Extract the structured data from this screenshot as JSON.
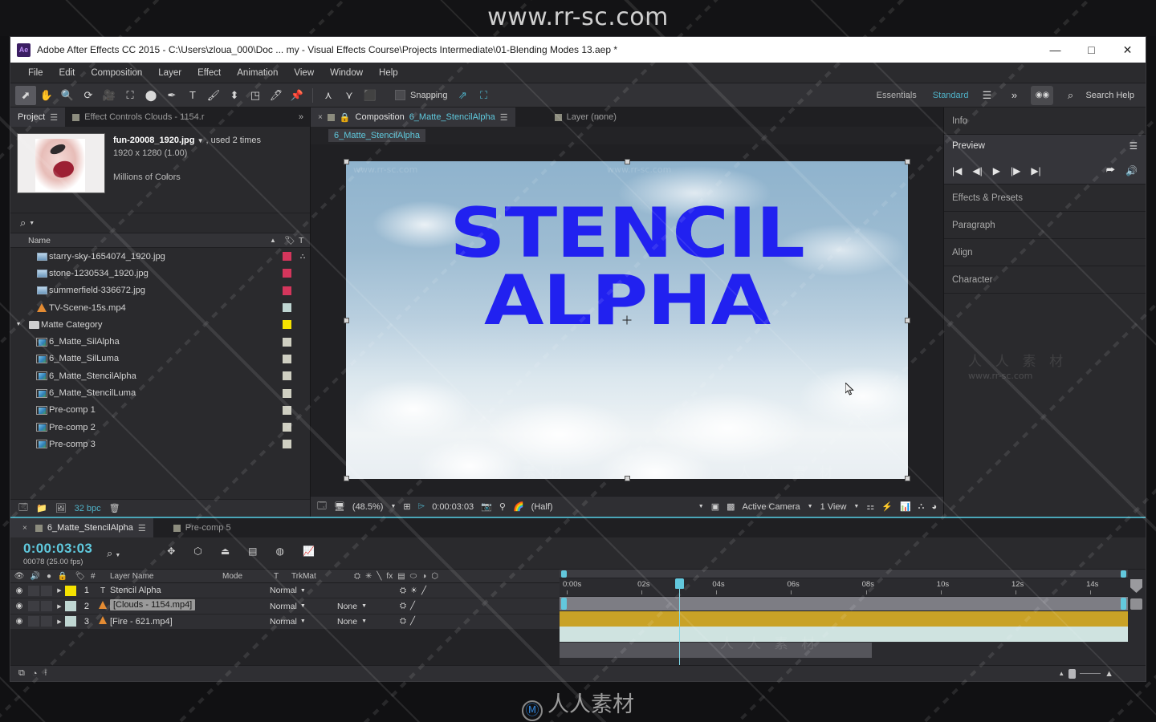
{
  "watermarks": {
    "top_url": "www.rr-sc.com",
    "bottom_brand": "人人素材",
    "overlay_url": "www.rr-sc.com",
    "overlay_cn": "人 人 素 材"
  },
  "titlebar": {
    "logo": "Ae",
    "title": "Adobe After Effects CC 2015 - C:\\Users\\zloua_000\\Doc ... my - Visual Effects Course\\Projects Intermediate\\01-Blending Modes 13.aep *",
    "minimize": "—",
    "maximize": "□",
    "close": "✕"
  },
  "menubar": {
    "items": [
      "File",
      "Edit",
      "Composition",
      "Layer",
      "Effect",
      "Animation",
      "View",
      "Window",
      "Help"
    ]
  },
  "toolbar": {
    "tools": [
      {
        "name": "selection-tool",
        "glyph": "⬈",
        "selected": true
      },
      {
        "name": "hand-tool",
        "glyph": "✋",
        "selected": false
      },
      {
        "name": "zoom-tool",
        "glyph": "🔍",
        "selected": false
      },
      {
        "name": "rotation-tool",
        "glyph": "⟳",
        "selected": false
      },
      {
        "name": "camera-tool",
        "glyph": "🎥",
        "selected": false
      },
      {
        "name": "pan-behind-tool",
        "glyph": "⛶",
        "selected": false
      },
      {
        "name": "shape-tool",
        "glyph": "⬤",
        "selected": false
      },
      {
        "name": "pen-tool",
        "glyph": "✒",
        "selected": false
      },
      {
        "name": "text-tool",
        "glyph": "T",
        "selected": false
      },
      {
        "name": "brush-tool",
        "glyph": "🖌",
        "selected": false
      },
      {
        "name": "clone-stamp-tool",
        "glyph": "⬍",
        "selected": false
      },
      {
        "name": "eraser-tool",
        "glyph": "◳",
        "selected": false
      },
      {
        "name": "roto-brush-tool",
        "glyph": "🖊",
        "selected": false
      },
      {
        "name": "puppet-pin-tool",
        "glyph": "📌",
        "selected": false
      }
    ],
    "puppet_tools": [
      {
        "name": "puppet-position-tool",
        "glyph": "⋏"
      },
      {
        "name": "puppet-starch-tool",
        "glyph": "⋎"
      },
      {
        "name": "puppet-overlap-tool",
        "glyph": "⬛"
      }
    ],
    "snapping_label": "Snapping",
    "snapping_icons": [
      "magnet-icon",
      "grid-snap-icon"
    ],
    "workspaces": [
      {
        "label": "Essentials",
        "active": false
      },
      {
        "label": "Standard",
        "active": true
      }
    ],
    "workspace_menu_icon": "hamburger-icon",
    "overflow_icon": "chevron-double-right-icon",
    "adobe_link_icon": "creative-cloud-icon",
    "search_help_placeholder": "Search Help",
    "search_icon": "search-icon"
  },
  "project_panel": {
    "tabs": [
      {
        "label": "Project",
        "active": true,
        "has_menu": true
      },
      {
        "label": "Effect Controls Clouds - 1154.r",
        "active": false,
        "has_menu": false
      }
    ],
    "overflow_icon": "chevron-double-right-icon",
    "selected_asset": {
      "filename": "fun-20008_1920.jpg",
      "used": ", used 2 times",
      "dimensions": "1920 x 1280 (1.00)",
      "color_depth": "Millions of Colors",
      "dropdown_icon": "caret-down-icon"
    },
    "search_icon": "search-icon",
    "columns": {
      "name": "Name",
      "sort_icon": "caret-up-icon",
      "tag": "tag-icon",
      "type": "T"
    },
    "items": [
      {
        "name": "starry-sky-1654074_1920.jpg",
        "icon": "image-icon",
        "indent": 1,
        "swatch": "#d4365c",
        "extra": "share-icon"
      },
      {
        "name": "stone-1230534_1920.jpg",
        "icon": "image-icon",
        "indent": 1,
        "swatch": "#d4365c",
        "extra": ""
      },
      {
        "name": "summerfield-336672.jpg",
        "icon": "image-icon",
        "indent": 1,
        "swatch": "#d4365c",
        "extra": ""
      },
      {
        "name": "TV-Scene-15s.mp4",
        "icon": "video-icon",
        "indent": 1,
        "swatch": "#bfd6d2",
        "extra": ""
      },
      {
        "name": "Matte Category",
        "icon": "folder-icon",
        "indent": 0,
        "swatch": "#f5e200",
        "extra": "",
        "expanded": true
      },
      {
        "name": "6_Matte_SilAlpha",
        "icon": "comp-icon",
        "indent": 1,
        "swatch": "#cfcfc2",
        "extra": ""
      },
      {
        "name": "6_Matte_SilLuma",
        "icon": "comp-icon",
        "indent": 1,
        "swatch": "#cfcfc2",
        "extra": ""
      },
      {
        "name": "6_Matte_StencilAlpha",
        "icon": "comp-icon",
        "indent": 1,
        "swatch": "#cfcfc2",
        "extra": ""
      },
      {
        "name": "6_Matte_StencilLuma",
        "icon": "comp-icon",
        "indent": 1,
        "swatch": "#cfcfc2",
        "extra": ""
      },
      {
        "name": "Pre-comp 1",
        "icon": "comp-icon",
        "indent": 1,
        "swatch": "#cfcfc2",
        "extra": ""
      },
      {
        "name": "Pre-comp 2",
        "icon": "comp-icon",
        "indent": 1,
        "swatch": "#cfcfc2",
        "extra": ""
      },
      {
        "name": "Pre-comp 3",
        "icon": "comp-icon",
        "indent": 1,
        "swatch": "#cfcfc2",
        "extra": ""
      }
    ],
    "footer": {
      "new_comp_icon": "new-composition-icon",
      "new_folder_icon": "new-folder-icon",
      "new_footage_icon": "new-footage-icon",
      "bit_depth": "32 bpc",
      "delete_icon": "trash-icon"
    }
  },
  "comp_panel": {
    "tabs": [
      {
        "close": "×",
        "label_prefix": "Composition",
        "label_name": "6_Matte_StencilAlpha",
        "active": true,
        "lock_icon": "lock-icon",
        "menu_icon": "hamburger-icon"
      },
      {
        "label": "Layer (none)",
        "active": false
      }
    ],
    "breadcrumb": "6_Matte_StencilAlpha",
    "canvas_text": [
      "STENCIL",
      "ALPHA"
    ],
    "canvas_text_color": "#2121f0",
    "footer": {
      "main_view_icon": "main-view-icon",
      "always_preview_icon": "monitor-icon",
      "zoom": "(48.5%)",
      "zoom_caret": "caret-down-icon",
      "grid_icon": "grid-guides-icon",
      "mask_icon": "mask-guide-icon",
      "time": "0:00:03:03",
      "snapshot_icon": "camera-icon",
      "show_snapshot_icon": "show-snapshot-icon",
      "channel_icon": "rgb-channels-icon",
      "resolution": "(Half)",
      "resolution_caret": "caret-down-icon",
      "region_icon": "region-of-interest-icon",
      "transparency_icon": "transparency-grid-icon",
      "camera": "Active Camera",
      "camera_caret": "caret-down-icon",
      "views": "1 View",
      "views_caret": "caret-down-icon",
      "pixel_aspect_icon": "pixel-aspect-icon",
      "fast_preview_icon": "fast-preview-icon",
      "timeline_icon": "timeline-icon",
      "comp_flow_icon": "comp-flowchart-icon",
      "reset_exposure_icon": "reset-exposure-icon"
    }
  },
  "right_dock": {
    "panels": [
      {
        "label": "Info",
        "type": "header"
      },
      {
        "label": "Preview",
        "type": "expanded",
        "menu_icon": "hamburger-icon"
      },
      {
        "label": "Effects & Presets",
        "type": "header"
      },
      {
        "label": "Paragraph",
        "type": "header"
      },
      {
        "label": "Align",
        "type": "header"
      },
      {
        "label": "Character",
        "type": "header"
      }
    ],
    "preview_controls": [
      {
        "name": "first-frame-button",
        "glyph": "|◀"
      },
      {
        "name": "previous-frame-button",
        "glyph": "◀|"
      },
      {
        "name": "play-button",
        "glyph": "▶"
      },
      {
        "name": "next-frame-button",
        "glyph": "|▶"
      },
      {
        "name": "last-frame-button",
        "glyph": "▶|"
      },
      {
        "name": "loop-button",
        "glyph": "⮫"
      },
      {
        "name": "mute-audio-button",
        "glyph": "🔊"
      }
    ]
  },
  "timeline": {
    "tabs": [
      {
        "close": "×",
        "label": "6_Matte_StencilAlpha",
        "active": true,
        "menu_icon": "hamburger-icon"
      },
      {
        "label": "Pre-comp 5",
        "active": false
      }
    ],
    "current_time": "0:00:03:03",
    "frame_info": "00078 (25.00 fps)",
    "search_icon": "search-icon",
    "header_icons": [
      {
        "name": "live-update-icon",
        "glyph": "✥"
      },
      {
        "name": "draft-3d-icon",
        "glyph": "⬡"
      },
      {
        "name": "hide-shy-layers-icon",
        "glyph": "⏏"
      },
      {
        "name": "frame-blending-icon",
        "glyph": "▤"
      },
      {
        "name": "motion-blur-icon",
        "glyph": "◍"
      },
      {
        "name": "graph-editor-icon",
        "glyph": "📈"
      }
    ],
    "columns": {
      "eye": "eye-icon",
      "audio": "speaker-icon",
      "solo": "solo-icon",
      "lock": "lock-icon",
      "tag": "tag-icon",
      "num": "#",
      "layer_name": "Layer Name",
      "mode": "Mode",
      "t": "T",
      "trkmat": "TrkMat",
      "switches": [
        "shy-icon",
        "collapse-icon",
        "quality-icon",
        "fx-icon",
        "frame-blend-icon",
        "motion-blur-icon",
        "adjustment-icon",
        "3d-icon"
      ]
    },
    "layers": [
      {
        "num": "1",
        "name": "Stencil Alpha",
        "icon": "text-layer-icon",
        "label_color": "#f5e200",
        "mode": "Normal",
        "trkmat": "",
        "selected": false,
        "bar_color": "#c9a227",
        "bar_start_pct": 0,
        "bar_width_pct": 100,
        "switches": [
          "⛭",
          "☀",
          "╱"
        ]
      },
      {
        "num": "2",
        "name": "[Clouds - 1154.mp4]",
        "icon": "video-layer-icon",
        "label_color": "#bfd6d2",
        "mode": "Normal",
        "trkmat": "None",
        "selected": true,
        "bar_color": "#cfe3e0",
        "bar_start_pct": 0,
        "bar_width_pct": 100,
        "switches": [
          "⛭",
          "╱"
        ]
      },
      {
        "num": "3",
        "name": "[Fire - 621.mp4]",
        "icon": "video-layer-icon",
        "label_color": "#bfd6d2",
        "mode": "Normal",
        "trkmat": "None",
        "selected": false,
        "bar_color": "#55555b",
        "bar_start_pct": 0,
        "bar_width_pct": 55,
        "switches": [
          "⛭",
          "╱"
        ]
      }
    ],
    "ruler_ticks": [
      "0:00s",
      "02s",
      "04s",
      "06s",
      "08s",
      "10s",
      "12s",
      "14s"
    ],
    "playhead_time_pct": 21,
    "footer": {
      "toggle_switches_icon": "toggle-switches-modes-icon",
      "graph-icon": "graph-icon",
      "stretch_icon": "stretch-icon",
      "zoom_out_icon": "zoom-out-icon",
      "zoom_in_icon": "zoom-in-icon"
    }
  }
}
